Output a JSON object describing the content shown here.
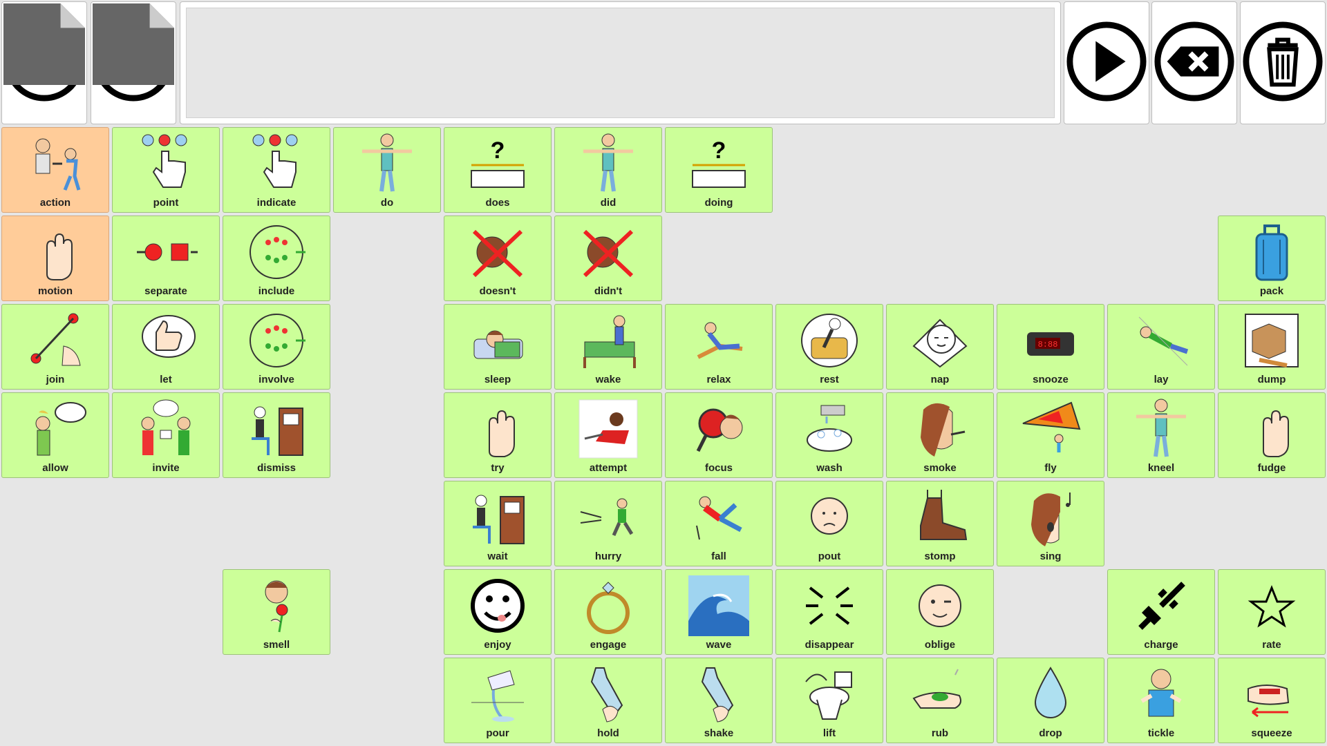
{
  "toolbar": {
    "left": [
      {
        "name": "home-button",
        "icon": "home-icon"
      },
      {
        "name": "undo-button",
        "icon": "undo-icon"
      }
    ],
    "message_text": "",
    "right": [
      {
        "name": "speak-button",
        "icon": "play-icon"
      },
      {
        "name": "backspace-button",
        "icon": "backspace-icon"
      },
      {
        "name": "clear-button",
        "icon": "trash-icon"
      }
    ]
  },
  "colors": {
    "cell_green": "#ccff99",
    "cell_peach": "#ffcc99",
    "background": "#e6e6e6"
  },
  "grid": {
    "columns": 12,
    "rows": 7,
    "cells": [
      {
        "label": "action",
        "row": 0,
        "col": 0,
        "color": "peach",
        "icon": "person-walking-icon"
      },
      {
        "label": "point",
        "row": 0,
        "col": 1,
        "color": "green",
        "icon": "pointing-hand-icon"
      },
      {
        "label": "indicate",
        "row": 0,
        "col": 2,
        "color": "green",
        "icon": "pointing-hand-icon"
      },
      {
        "label": "do",
        "row": 0,
        "col": 3,
        "color": "green",
        "icon": "person-icon"
      },
      {
        "label": "does",
        "row": 0,
        "col": 4,
        "color": "green",
        "icon": "question-icon"
      },
      {
        "label": "did",
        "row": 0,
        "col": 5,
        "color": "green",
        "icon": "person-icon"
      },
      {
        "label": "doing",
        "row": 0,
        "col": 6,
        "color": "green",
        "icon": "question-icon"
      },
      {
        "label": "motion",
        "row": 1,
        "col": 0,
        "color": "peach",
        "icon": "hand-icon"
      },
      {
        "label": "separate",
        "row": 1,
        "col": 1,
        "color": "green",
        "icon": "separate-icon"
      },
      {
        "label": "include",
        "row": 1,
        "col": 2,
        "color": "green",
        "icon": "group-icon"
      },
      {
        "label": "doesn't",
        "row": 1,
        "col": 4,
        "color": "green",
        "icon": "cross-icon"
      },
      {
        "label": "didn't",
        "row": 1,
        "col": 5,
        "color": "green",
        "icon": "cross-icon"
      },
      {
        "label": "pack",
        "row": 1,
        "col": 11,
        "color": "green",
        "icon": "suitcase-icon"
      },
      {
        "label": "join",
        "row": 2,
        "col": 0,
        "color": "green",
        "icon": "join-icon"
      },
      {
        "label": "let",
        "row": 2,
        "col": 1,
        "color": "green",
        "icon": "thumbs-up-icon"
      },
      {
        "label": "involve",
        "row": 2,
        "col": 2,
        "color": "green",
        "icon": "group-icon"
      },
      {
        "label": "sleep",
        "row": 2,
        "col": 4,
        "color": "green",
        "icon": "sleep-icon"
      },
      {
        "label": "wake",
        "row": 2,
        "col": 5,
        "color": "green",
        "icon": "bed-icon"
      },
      {
        "label": "relax",
        "row": 2,
        "col": 6,
        "color": "green",
        "icon": "chair-icon"
      },
      {
        "label": "rest",
        "row": 2,
        "col": 7,
        "color": "green",
        "icon": "armchair-icon"
      },
      {
        "label": "nap",
        "row": 2,
        "col": 8,
        "color": "green",
        "icon": "sleep-face-icon"
      },
      {
        "label": "snooze",
        "row": 2,
        "col": 9,
        "color": "green",
        "icon": "alarm-clock-icon"
      },
      {
        "label": "lay",
        "row": 2,
        "col": 10,
        "color": "green",
        "icon": "person-lying-icon"
      },
      {
        "label": "dump",
        "row": 2,
        "col": 11,
        "color": "green",
        "icon": "box-icon"
      },
      {
        "label": "allow",
        "row": 3,
        "col": 0,
        "color": "green",
        "icon": "speech-icon"
      },
      {
        "label": "invite",
        "row": 3,
        "col": 1,
        "color": "green",
        "icon": "invite-icon"
      },
      {
        "label": "dismiss",
        "row": 3,
        "col": 2,
        "color": "green",
        "icon": "door-icon"
      },
      {
        "label": "try",
        "row": 3,
        "col": 4,
        "color": "green",
        "icon": "hand-icon"
      },
      {
        "label": "attempt",
        "row": 3,
        "col": 5,
        "color": "green",
        "icon": "photo-icon"
      },
      {
        "label": "focus",
        "row": 3,
        "col": 6,
        "color": "green",
        "icon": "magnifier-icon"
      },
      {
        "label": "wash",
        "row": 3,
        "col": 7,
        "color": "green",
        "icon": "water-icon"
      },
      {
        "label": "smoke",
        "row": 3,
        "col": 8,
        "color": "green",
        "icon": "face-icon"
      },
      {
        "label": "fly",
        "row": 3,
        "col": 9,
        "color": "green",
        "icon": "glider-icon"
      },
      {
        "label": "kneel",
        "row": 3,
        "col": 10,
        "color": "green",
        "icon": "person-icon"
      },
      {
        "label": "fudge",
        "row": 3,
        "col": 11,
        "color": "green",
        "icon": "hand-icon"
      },
      {
        "label": "wait",
        "row": 4,
        "col": 4,
        "color": "green",
        "icon": "door-icon"
      },
      {
        "label": "hurry",
        "row": 4,
        "col": 5,
        "color": "green",
        "icon": "running-icon"
      },
      {
        "label": "fall",
        "row": 4,
        "col": 6,
        "color": "green",
        "icon": "falling-icon"
      },
      {
        "label": "pout",
        "row": 4,
        "col": 7,
        "color": "green",
        "icon": "sad-face-icon"
      },
      {
        "label": "stomp",
        "row": 4,
        "col": 8,
        "color": "green",
        "icon": "boot-icon"
      },
      {
        "label": "sing",
        "row": 4,
        "col": 9,
        "color": "green",
        "icon": "music-icon"
      },
      {
        "label": "smell",
        "row": 5,
        "col": 2,
        "color": "green",
        "icon": "flower-icon"
      },
      {
        "label": "enjoy",
        "row": 5,
        "col": 4,
        "color": "green",
        "icon": "smile-face-icon"
      },
      {
        "label": "engage",
        "row": 5,
        "col": 5,
        "color": "green",
        "icon": "ring-icon"
      },
      {
        "label": "wave",
        "row": 5,
        "col": 6,
        "color": "green",
        "icon": "ocean-wave-icon"
      },
      {
        "label": "disappear",
        "row": 5,
        "col": 7,
        "color": "green",
        "icon": "vanish-icon"
      },
      {
        "label": "oblige",
        "row": 5,
        "col": 8,
        "color": "green",
        "icon": "wink-face-icon"
      },
      {
        "label": "charge",
        "row": 5,
        "col": 10,
        "color": "green",
        "icon": "plug-icon"
      },
      {
        "label": "rate",
        "row": 5,
        "col": 11,
        "color": "green",
        "icon": "star-icon"
      },
      {
        "label": "pour",
        "row": 6,
        "col": 4,
        "color": "green",
        "icon": "glass-icon"
      },
      {
        "label": "hold",
        "row": 6,
        "col": 5,
        "color": "green",
        "icon": "bottle-icon"
      },
      {
        "label": "shake",
        "row": 6,
        "col": 6,
        "color": "green",
        "icon": "bottle-icon"
      },
      {
        "label": "lift",
        "row": 6,
        "col": 7,
        "color": "green",
        "icon": "toilet-icon"
      },
      {
        "label": "rub",
        "row": 6,
        "col": 8,
        "color": "green",
        "icon": "soap-icon"
      },
      {
        "label": "drop",
        "row": 6,
        "col": 9,
        "color": "green",
        "icon": "droplet-icon"
      },
      {
        "label": "tickle",
        "row": 6,
        "col": 10,
        "color": "green",
        "icon": "laugh-icon"
      },
      {
        "label": "squeeze",
        "row": 6,
        "col": 11,
        "color": "green",
        "icon": "squeeze-icon"
      }
    ]
  }
}
